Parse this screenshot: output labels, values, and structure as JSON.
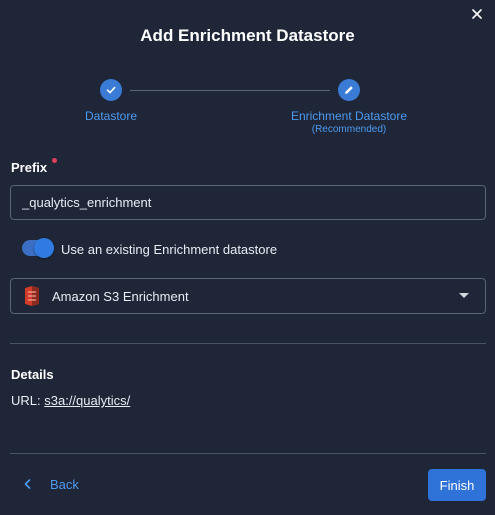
{
  "dialog": {
    "title": "Add Enrichment Datastore",
    "close_icon": "close-icon"
  },
  "stepper": {
    "steps": [
      {
        "label": "Datastore",
        "icon": "check-icon",
        "state": "completed"
      },
      {
        "label": "Enrichment Datastore",
        "sublabel": "(Recommended)",
        "icon": "pencil-icon",
        "state": "active"
      }
    ]
  },
  "form": {
    "prefix_label": "Prefix",
    "prefix_value": "_qualytics_enrichment",
    "toggle_label": "Use an existing Enrichment datastore",
    "toggle_on": true,
    "datastore_select": {
      "selected": "Amazon S3 Enrichment",
      "icon": "amazon-s3-icon"
    }
  },
  "details": {
    "heading": "Details",
    "url_label": "URL:",
    "url_value": "s3a://qualytics/"
  },
  "footer": {
    "back_label": "Back",
    "finish_label": "Finish"
  },
  "colors": {
    "background": "#1e2638",
    "accent": "#2f72d8",
    "link": "#4f9aef",
    "required": "#e0405a",
    "s3_red": "#d13b2a"
  }
}
